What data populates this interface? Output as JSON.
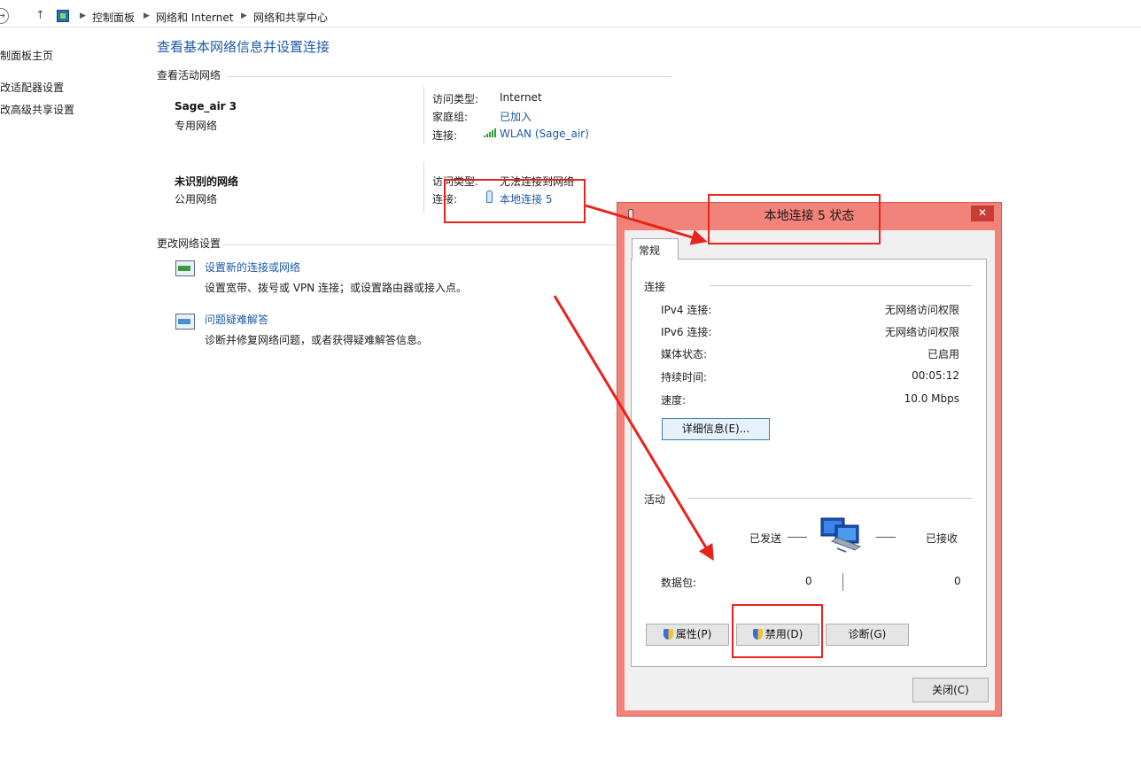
{
  "address_bar": {
    "crumbs": [
      "控制面板",
      "网络和 Internet",
      "网络和共享中心"
    ]
  },
  "left_pane": {
    "items": [
      "制面板主页",
      "改适配器设置",
      "改高级共享设置"
    ]
  },
  "main": {
    "title": "查看基本网络信息并设置连接",
    "active_title": "查看活动网络",
    "networks": [
      {
        "name": "Sage_air  3",
        "category": "专用网络",
        "access_label": "访问类型:",
        "access_value": "Internet",
        "homegroup_label": "家庭组:",
        "homegroup_value": "已加入",
        "conn_label": "连接:",
        "conn_value": "WLAN (Sage_air)"
      },
      {
        "name": "未识别的网络",
        "category": "公用网络",
        "access_label": "访问类型:",
        "access_value": "无法连接到网络",
        "conn_label": "连接:",
        "conn_value": "本地连接 5"
      }
    ],
    "change_title": "更改网络设置",
    "tasks": [
      {
        "link": "设置新的连接或网络",
        "desc": "设置宽带、拨号或 VPN 连接；或设置路由器或接入点。"
      },
      {
        "link": "问题疑难解答",
        "desc": "诊断并修复网络问题，或者获得疑难解答信息。"
      }
    ]
  },
  "dialog": {
    "title": "本地连接 5 状态",
    "close_symbol": "✕",
    "tab": "常规",
    "connection_group": "连接",
    "rows": [
      {
        "label": "IPv4 连接:",
        "value": "无网络访问权限"
      },
      {
        "label": "IPv6 连接:",
        "value": "无网络访问权限"
      },
      {
        "label": "媒体状态:",
        "value": "已启用"
      },
      {
        "label": "持续时间:",
        "value": "00:05:12"
      },
      {
        "label": "速度:",
        "value": "10.0 Mbps"
      }
    ],
    "details_button": "详细信息(E)...",
    "activity_group": "活动",
    "sent_label": "已发送",
    "received_label": "已接收",
    "packets_label": "数据包:",
    "packets_sent": "0",
    "packets_received": "0",
    "buttons": {
      "properties": "属性(P)",
      "disable": "禁用(D)",
      "diagnose": "诊断(G)",
      "close": "关闭(C)"
    }
  },
  "colors": {
    "link": "#1e5aa8",
    "dialog_frame": "#f1837a",
    "annotation": "#e8231b"
  }
}
